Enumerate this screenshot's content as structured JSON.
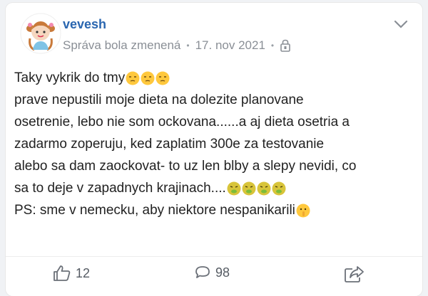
{
  "post": {
    "author": "vevesh",
    "edited_label": "Správa bola zmenená",
    "date": "17. nov 2021",
    "lines": [
      "Taky vykrik do tmy",
      "prave nepustili moje dieta na dolezite planovane",
      "osetrenie, lebo nie som ockovana......a aj dieta osetria a",
      "zadarmo zoperuju, ked zaplatim 300e za testovanie",
      "alebo sa dam zaockovat- to uz len blby a slepy nevidi, co",
      "sa to deje v zapadnych krajinach....",
      "PS: sme v nemecku, aby niektore nespanikarili"
    ],
    "emojis": {
      "line1": [
        "unamused-face",
        "unamused-face",
        "unamused-face"
      ],
      "line6": [
        "nauseated-face",
        "nauseated-face",
        "nauseated-face",
        "nauseated-face"
      ],
      "line7": [
        "shushing-face"
      ]
    }
  },
  "actions": {
    "likes": "12",
    "comments": "98"
  },
  "icons": {
    "chevron": "chevron-down-icon",
    "lock": "lock-icon",
    "like": "thumbs-up-icon",
    "comment": "comment-bubble-icon",
    "share": "share-icon"
  },
  "colors": {
    "author": "#2a66b0",
    "meta": "#8a8f96",
    "text": "#222222",
    "action_icon": "#6b7078"
  }
}
